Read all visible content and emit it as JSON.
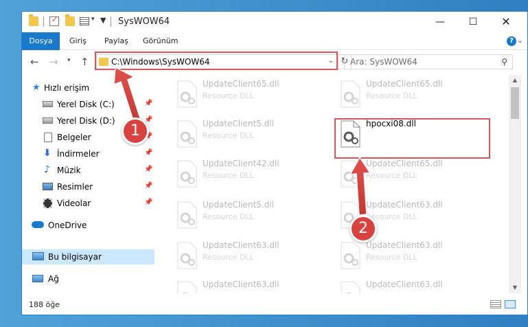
{
  "window": {
    "title": "SysWOW64"
  },
  "ribbon": {
    "tabs": [
      "Dosya",
      "Giriş",
      "Paylaş",
      "Görünüm"
    ],
    "help": "?"
  },
  "address": {
    "path": "C:\\Windows\\SysWOW64"
  },
  "search": {
    "placeholder": "Ara: SysWOW64"
  },
  "sidebar": {
    "items": [
      {
        "label": "Hızlı erişim",
        "icon": "star-icon"
      },
      {
        "label": "Yerel Disk (C:)",
        "icon": "drive-icon",
        "pinned": true
      },
      {
        "label": "Yerel Disk (D:)",
        "icon": "drive-icon",
        "pinned": true
      },
      {
        "label": "Belgeler",
        "icon": "documents-icon",
        "pinned": true
      },
      {
        "label": "İndirmeler",
        "icon": "download-icon",
        "pinned": true
      },
      {
        "label": "Müzik",
        "icon": "music-icon",
        "pinned": true
      },
      {
        "label": "Resimler",
        "icon": "pictures-icon",
        "pinned": true
      },
      {
        "label": "Videolar",
        "icon": "videos-icon",
        "pinned": true
      },
      {
        "label": "OneDrive",
        "icon": "cloud-icon"
      },
      {
        "label": "Bu bilgisayar",
        "icon": "computer-icon",
        "selected": true
      },
      {
        "label": "Ağ",
        "icon": "network-icon"
      }
    ]
  },
  "files": {
    "subtitle": "Resource DLL",
    "left_column": [
      "UpdateClient65.dll",
      "UpdateClient5.dll",
      "UpdateClient42.dll",
      "UpdateClient5.dll",
      "UpdateClient63.dll",
      "UpdateClient63.dll"
    ],
    "right_column": [
      "UpdateClient65.dll",
      "hpocxi08.dll",
      "UpdateClient65.dll",
      "UpdateClient63.dll",
      "UpdateClient63.dll",
      "UpdateClient63.dll"
    ],
    "highlighted": "hpocxi08.dll"
  },
  "status": {
    "count": "188 öğe"
  },
  "callouts": {
    "step1": "1",
    "step2": "2"
  },
  "colors": {
    "accent": "#1979ca",
    "highlight": "#d9535a",
    "badge": "#d9433f"
  }
}
